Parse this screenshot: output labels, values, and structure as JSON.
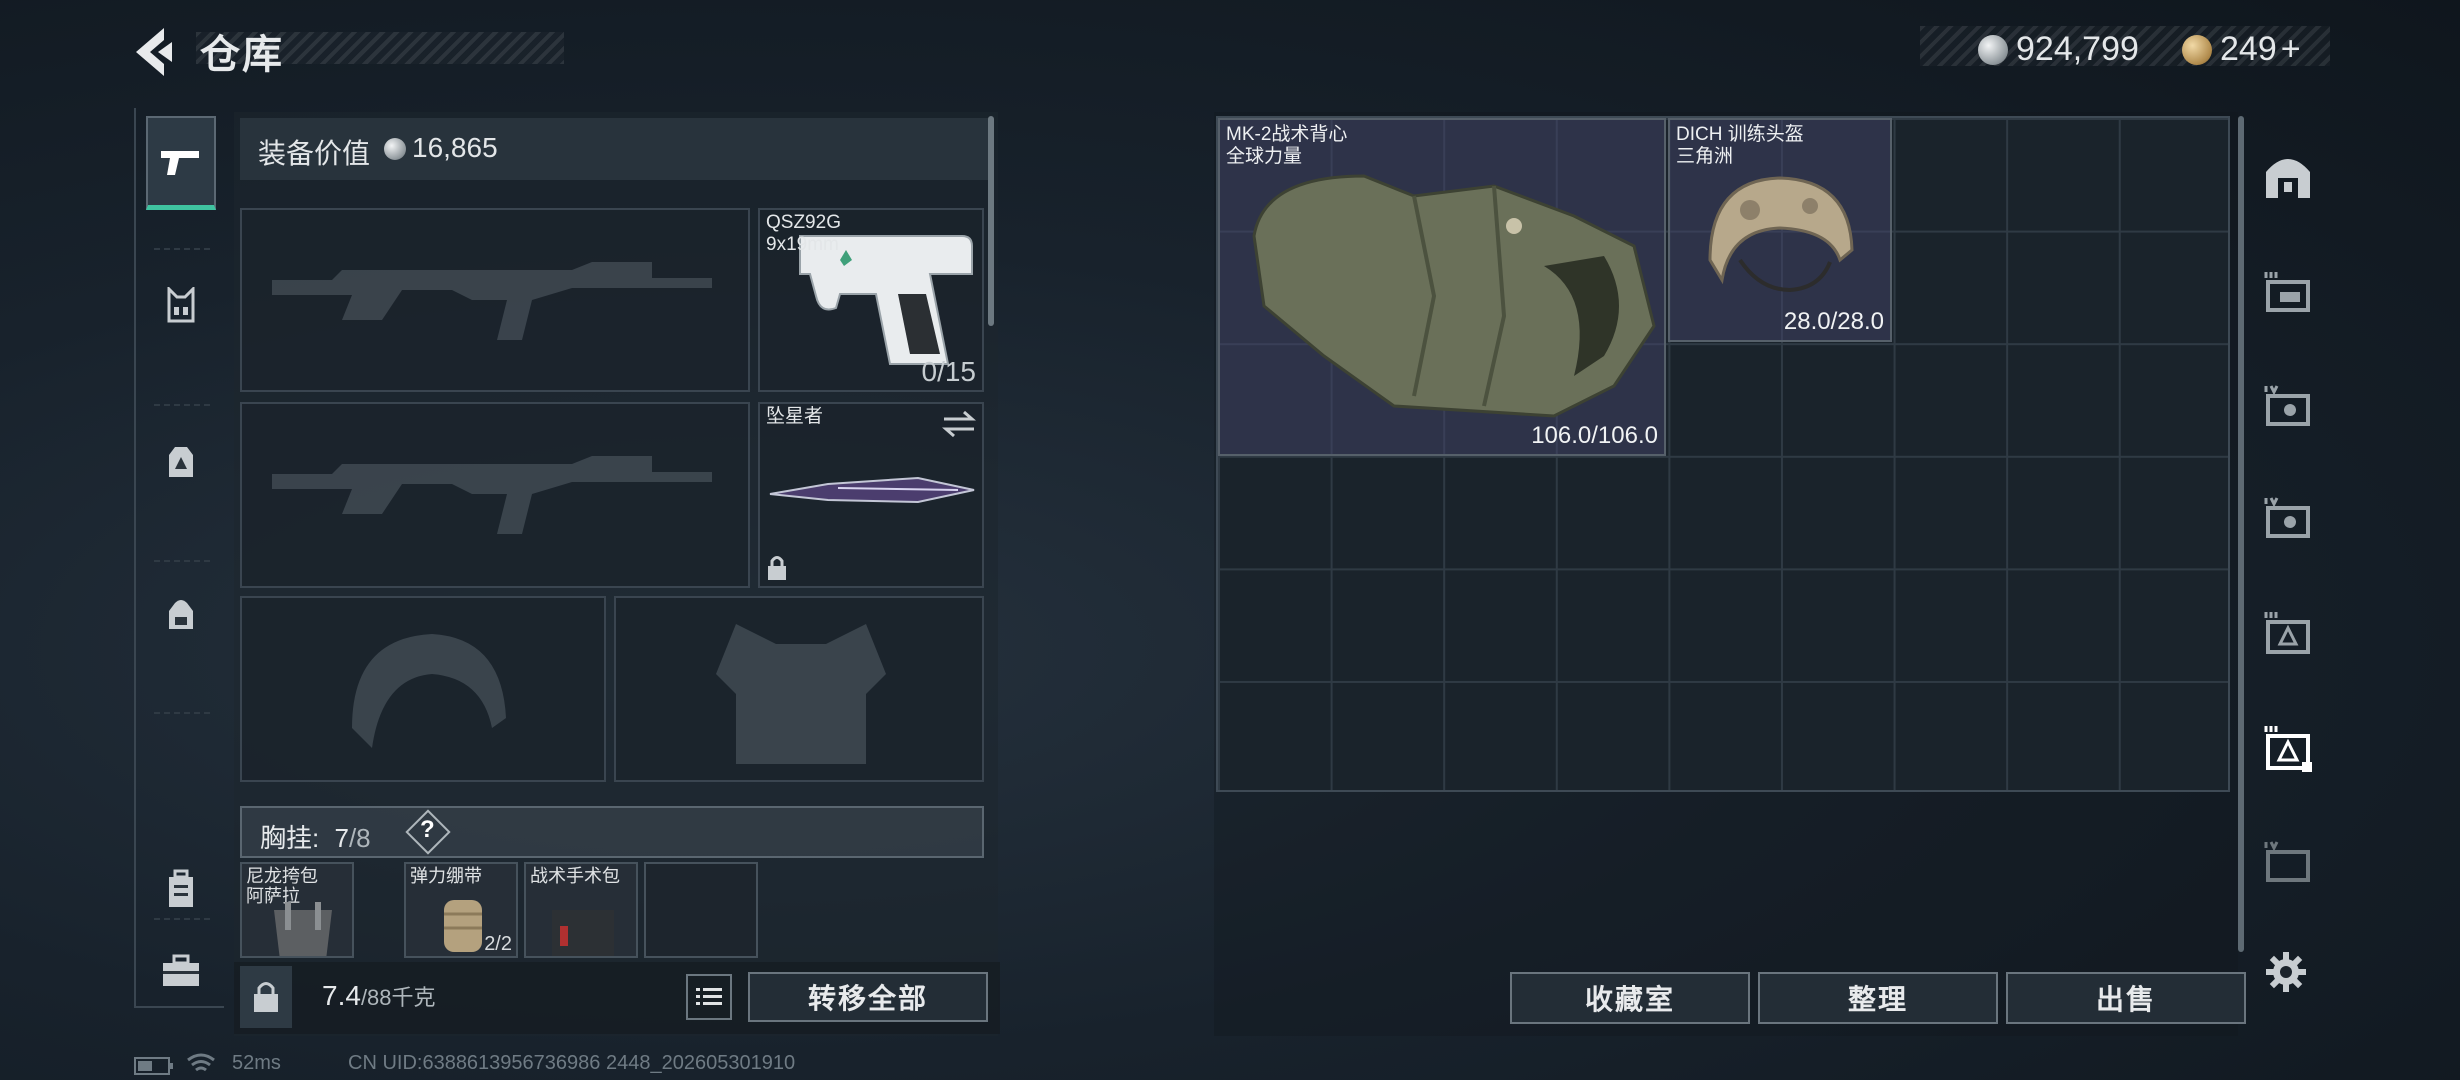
{
  "header": {
    "title": "仓库"
  },
  "currency": {
    "silver": "924,799",
    "gold": "249",
    "gold_suffix": "+"
  },
  "equipment": {
    "value_label": "装备价值",
    "value": "16,865",
    "pistol_name": "QSZ92G",
    "pistol_caliber": "9x19mm",
    "pistol_ammo": "0/15",
    "melee_name": "坠星者",
    "chest_label": "胸挂:",
    "chest_used": "7",
    "chest_total": "/8",
    "chest_help": "?",
    "pouches": [
      {
        "name": "尼龙挎包",
        "sub": "阿萨拉"
      },
      {
        "name": "弹力绷带",
        "count": "2/2"
      },
      {
        "name": "战术手术包"
      },
      {
        "name": ""
      }
    ]
  },
  "bottom_bar": {
    "weight": "7.4",
    "weight_max": "/88千克",
    "transfer_all": "转移全部"
  },
  "storage": {
    "items": [
      {
        "name": "MK-2战术背心",
        "sub": "全球力量",
        "durability": "106.0/106.0"
      },
      {
        "name": "DICH 训练头盔",
        "sub": "三角洲",
        "durability": "28.0/28.0"
      }
    ],
    "buttons": {
      "collection": "收藏室",
      "organize": "整理",
      "sell": "出售"
    }
  },
  "status": {
    "ping": "52ms",
    "uid": "CN UID:6388613956736986 2448_202605301910"
  },
  "colors": {
    "accent": "#3fc3a0",
    "panel": "#1b232b",
    "item_bg": "#48486e"
  },
  "icons": [
    "back-arrow-icon",
    "silver-coin-icon",
    "gold-coin-icon",
    "pistol-icon",
    "vest-icon",
    "backpack-icon",
    "bag-icon",
    "case-icon",
    "toolbox-icon",
    "lock-icon",
    "swap-icon",
    "list-icon",
    "warehouse-icon",
    "gear-icon",
    "battery-icon",
    "wifi-icon"
  ]
}
